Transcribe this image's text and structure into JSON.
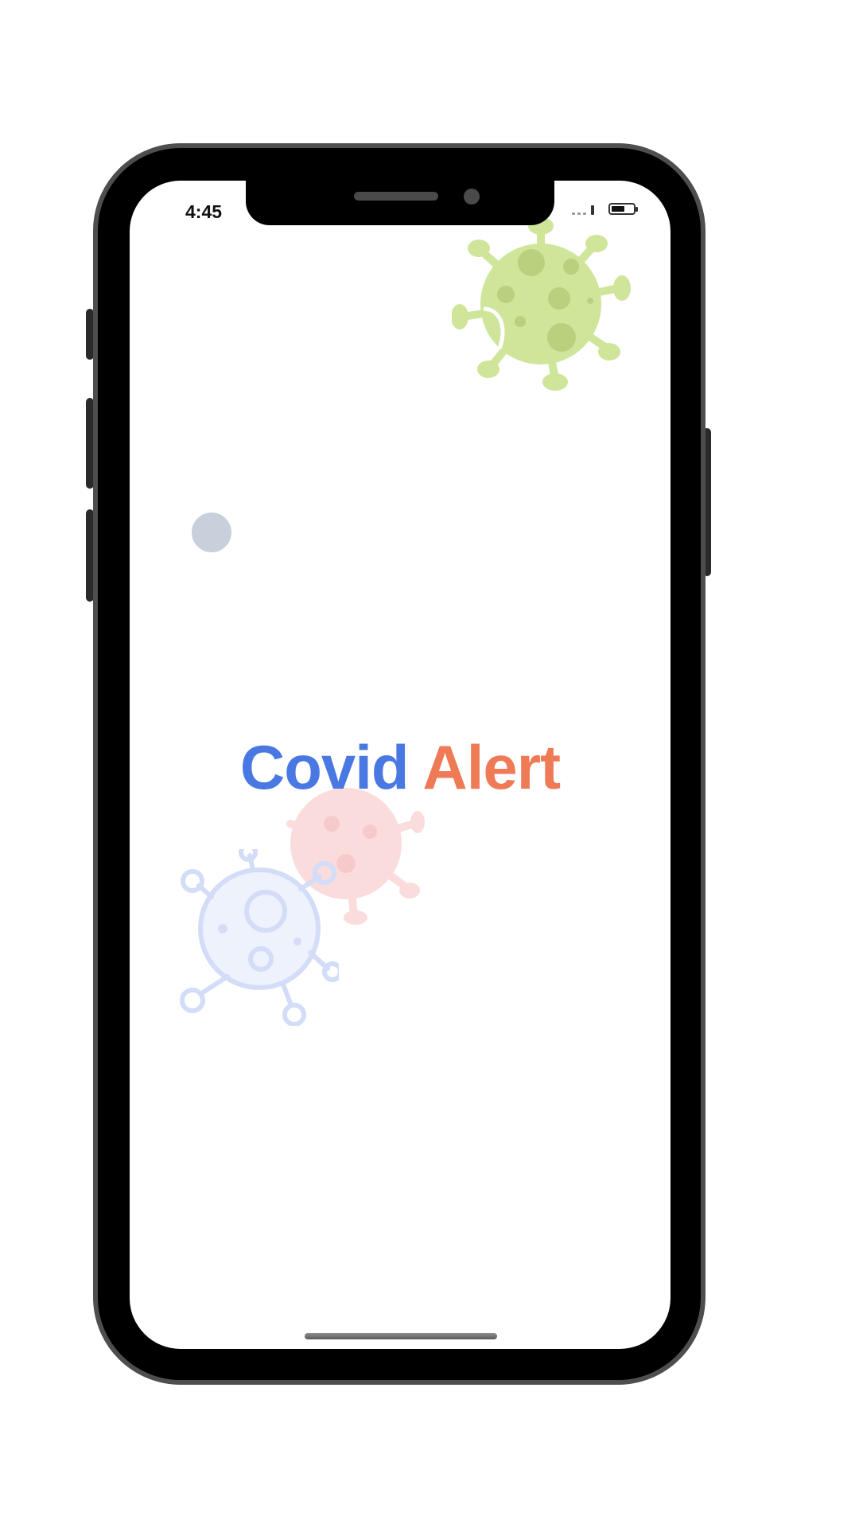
{
  "status_bar": {
    "time": "4:45",
    "signal_icon": "cellular-signal-icon",
    "battery_icon": "battery-icon"
  },
  "splash": {
    "title_word_1": "Covid",
    "title_word_2": "Alert",
    "title_color_1": "#4a78e3",
    "title_color_2": "#ef7a56"
  },
  "decorations": {
    "virus_top": "green-virus-icon",
    "virus_middle": "red-virus-icon",
    "virus_bottom": "blue-virus-outline-icon",
    "dot": "grey-dot",
    "colors": {
      "green": "#cfe59a",
      "red": "#fbdcdc",
      "blue": "#dde6fb",
      "dot": "#c7d0db"
    }
  }
}
